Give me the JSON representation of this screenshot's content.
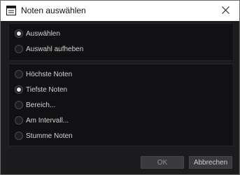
{
  "window": {
    "title": "Noten auswählen",
    "icon": "app-window-icon"
  },
  "selection_group": {
    "options": [
      {
        "label": "Auswählen",
        "checked": true
      },
      {
        "label": "Auswahl aufheben",
        "checked": false
      }
    ]
  },
  "notes_group": {
    "options": [
      {
        "label": "Höchste Noten",
        "checked": false
      },
      {
        "label": "Tiefste Noten",
        "checked": true
      },
      {
        "label": "Bereich...",
        "checked": false
      },
      {
        "label": "Am Intervall...",
        "checked": false
      },
      {
        "label": "Stumme Noten",
        "checked": false
      }
    ]
  },
  "buttons": {
    "ok_label": "OK",
    "cancel_label": "Abbrechen"
  }
}
